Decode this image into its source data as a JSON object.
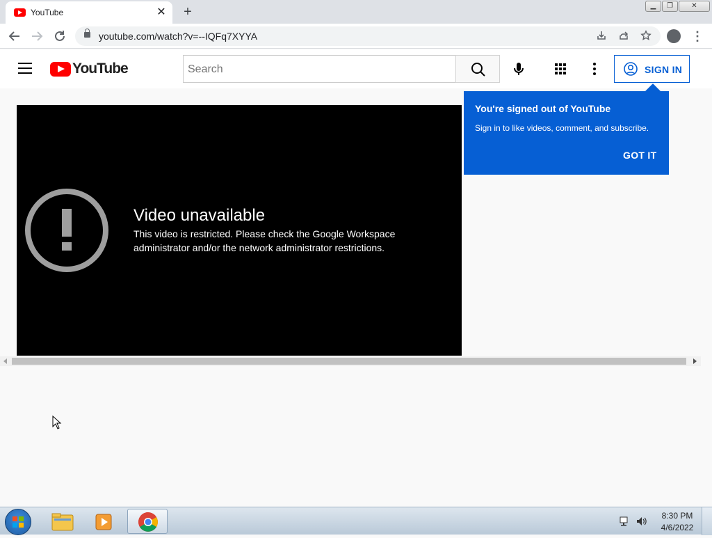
{
  "browser": {
    "tab_title": "YouTube",
    "tab_close": "✕",
    "new_tab": "+",
    "url": "youtube.com/watch?v=--IQFq7XYYA"
  },
  "masthead": {
    "logo_text": "YouTube",
    "search_placeholder": "Search",
    "signin_label": "SIGN IN"
  },
  "player": {
    "error_title": "Video unavailable",
    "error_message": "This video is restricted. Please check the Google Workspace administrator and/or the network administrator restrictions."
  },
  "popup": {
    "title": "You're signed out of YouTube",
    "body": "Sign in to like videos, comment, and subscribe.",
    "button": "GOT IT"
  },
  "taskbar": {
    "time": "8:30 PM",
    "date": "4/6/2022"
  },
  "colors": {
    "yt_red": "#ff0000",
    "yt_blue": "#065fd4"
  }
}
